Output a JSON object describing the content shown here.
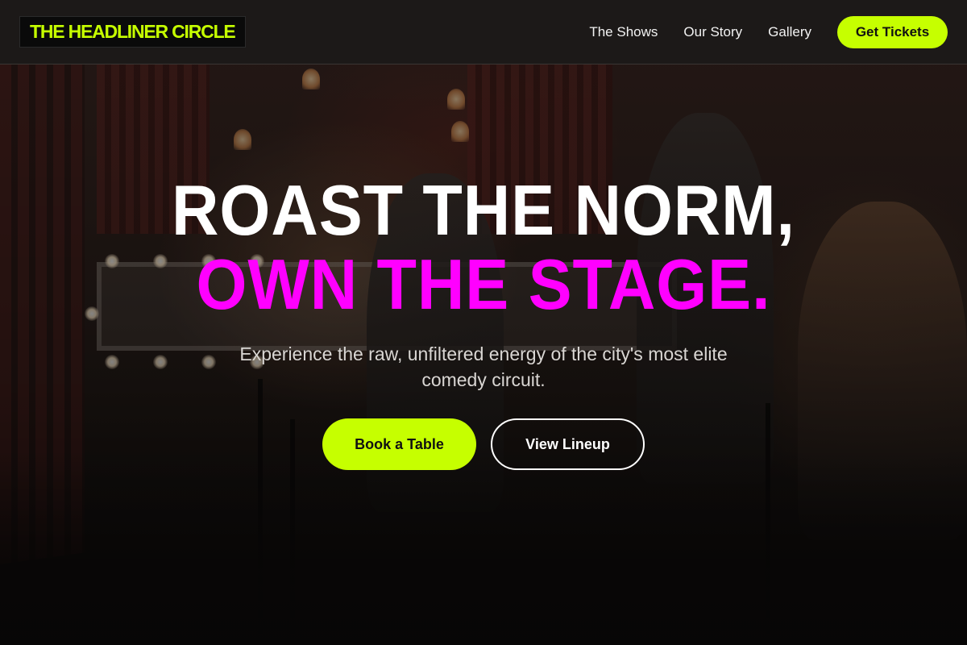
{
  "header": {
    "logo_text": "THE HEADLINER CIRCLE",
    "nav": [
      {
        "label": "The Shows"
      },
      {
        "label": "Our Story"
      },
      {
        "label": "Gallery"
      }
    ],
    "cta_label": "Get Tickets"
  },
  "hero": {
    "headline_line1": "ROAST THE NORM,",
    "headline_line2": "OWN THE STAGE.",
    "subtext": "Experience the raw, unfiltered energy of the city's most elite comedy circuit.",
    "primary_button": "Book a Table",
    "secondary_button": "View Lineup"
  },
  "colors": {
    "accent_lime": "#c6ff00",
    "accent_magenta": "#ff00ff",
    "header_bg": "#1c1a19"
  }
}
